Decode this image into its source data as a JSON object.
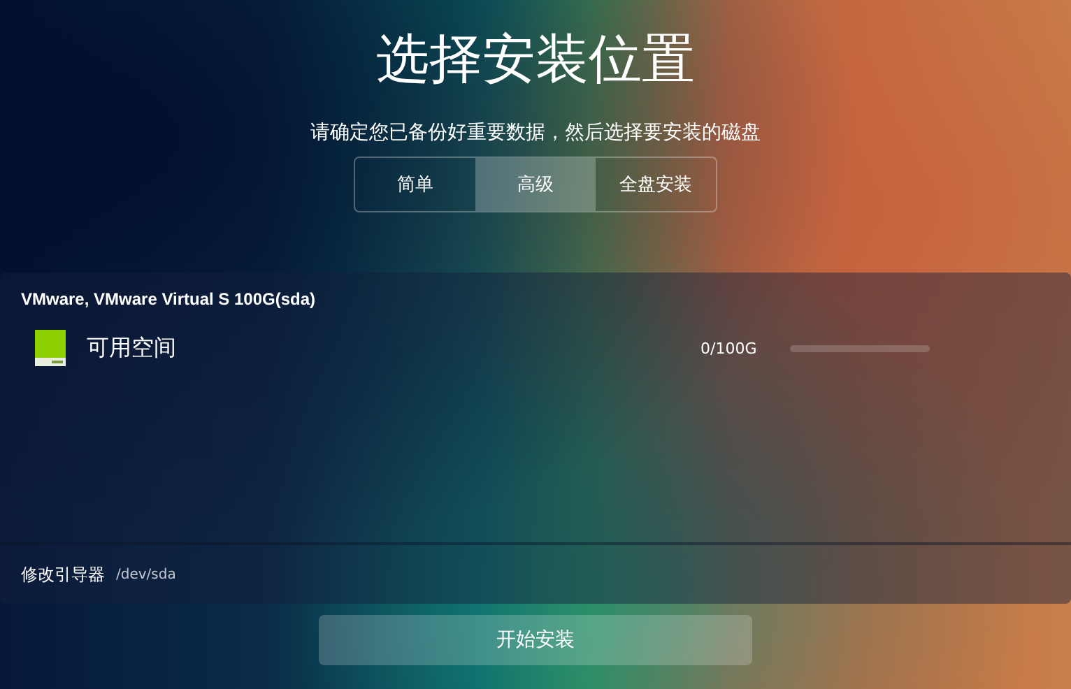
{
  "title": "选择安装位置",
  "subtitle": "请确定您已备份好重要数据，然后选择要安装的磁盘",
  "tabs": [
    {
      "label": "简单",
      "selected": false
    },
    {
      "label": "高级",
      "selected": true
    },
    {
      "label": "全盘安装",
      "selected": false
    }
  ],
  "disk": {
    "name": "VMware, VMware Virtual S 100G(sda)",
    "partitions": [
      {
        "label": "可用空间",
        "usage": "0/100G",
        "level": 0
      }
    ]
  },
  "bootloader": {
    "label": "修改引导器",
    "device": "/dev/sda"
  },
  "start_button": "开始安装"
}
